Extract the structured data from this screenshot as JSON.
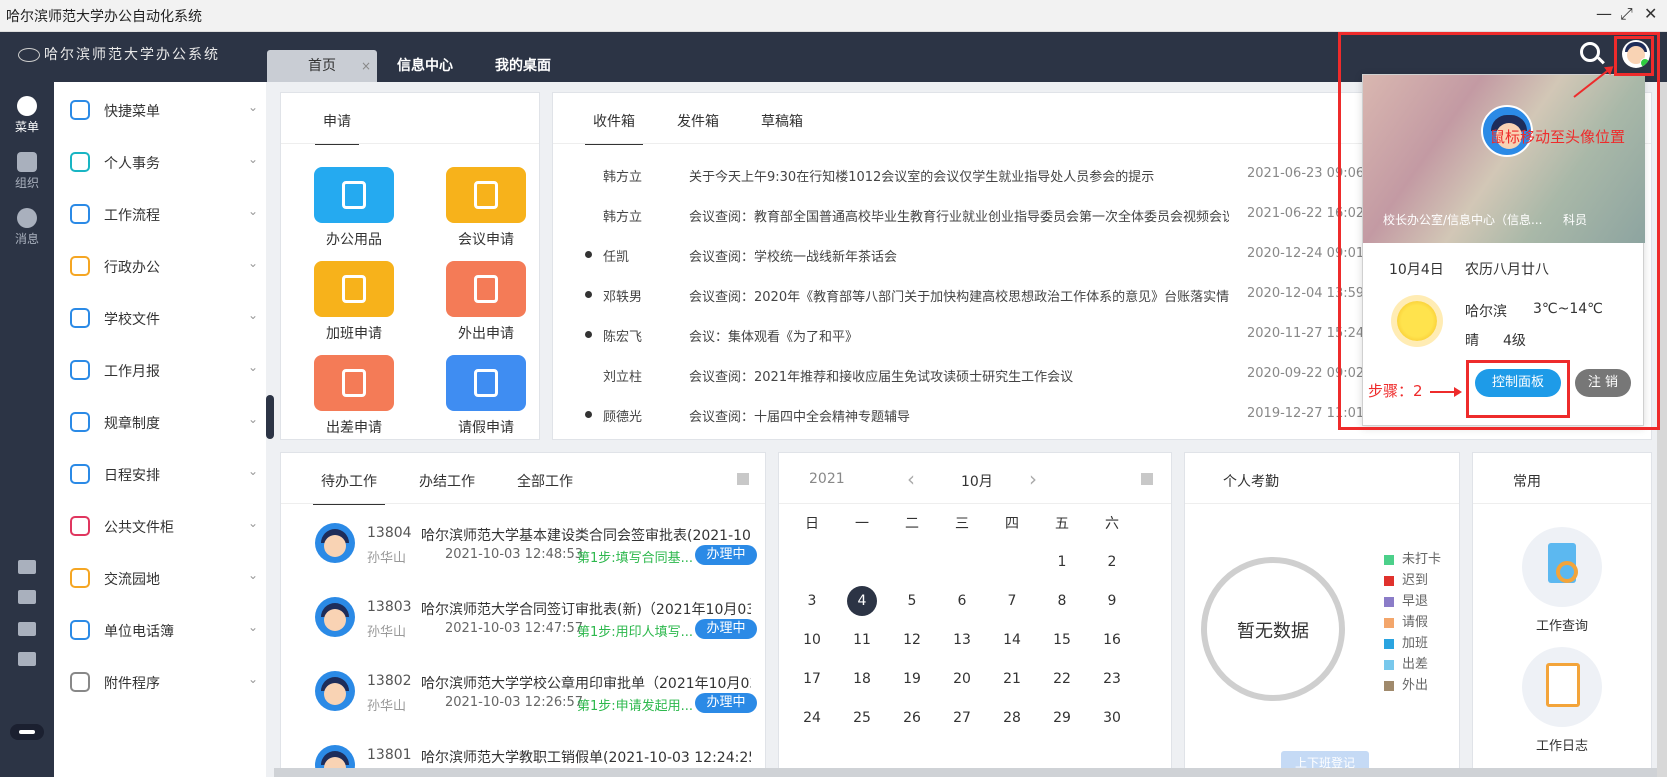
{
  "window": {
    "title": "哈尔滨师范大学办公自动化系统",
    "controls": [
      "—",
      "⤢",
      "✕"
    ]
  },
  "header": {
    "logo_text": "哈尔滨师范大学办公系统",
    "tabs": [
      {
        "label": "首页",
        "close": "×"
      },
      {
        "label": "信息中心"
      },
      {
        "label": "我的桌面"
      }
    ]
  },
  "rail": {
    "items": [
      {
        "label": "菜单",
        "icon": "grid-icon"
      },
      {
        "label": "组织",
        "icon": "people-icon"
      },
      {
        "label": "消息",
        "icon": "chat-icon"
      }
    ]
  },
  "sidebar": {
    "items": [
      {
        "label": "快捷菜单",
        "icon": "grid-menu-icon",
        "color": "#2b8ae6"
      },
      {
        "label": "个人事务",
        "icon": "user-icon",
        "color": "#19b5c3"
      },
      {
        "label": "工作流程",
        "icon": "workflow-icon",
        "color": "#2b8ae6"
      },
      {
        "label": "行政办公",
        "icon": "briefcase-icon",
        "color": "#f5a623"
      },
      {
        "label": "学校文件",
        "icon": "grid-menu-icon",
        "color": "#2b8ae6"
      },
      {
        "label": "工作月报",
        "icon": "grid-menu-icon",
        "color": "#2b8ae6"
      },
      {
        "label": "规章制度",
        "icon": "grid-menu-icon",
        "color": "#2b8ae6"
      },
      {
        "label": "日程安排",
        "icon": "grid-menu-icon",
        "color": "#2b8ae6"
      },
      {
        "label": "公共文件柜",
        "icon": "cabinet-icon",
        "color": "#e0365f"
      },
      {
        "label": "交流园地",
        "icon": "cup-icon",
        "color": "#f5a623"
      },
      {
        "label": "单位电话簿",
        "icon": "grid-menu-icon",
        "color": "#2b8ae6"
      },
      {
        "label": "附件程序",
        "icon": "paperclip-icon",
        "color": "#888888"
      }
    ]
  },
  "apply": {
    "tab": "申请",
    "apps": [
      {
        "label": "办公用品",
        "color": "#25aaf0"
      },
      {
        "label": "会议申请",
        "color": "#f7b21b"
      },
      {
        "label": "加班申请",
        "color": "#f7b21b"
      },
      {
        "label": "外出申请",
        "color": "#f47b57"
      },
      {
        "label": "出差申请",
        "color": "#f47b57"
      },
      {
        "label": "请假申请",
        "color": "#3f8df2"
      }
    ]
  },
  "mail": {
    "tabs": [
      "收件箱",
      "发件箱",
      "草稿箱"
    ],
    "rows": [
      {
        "unread": false,
        "from": "韩方立",
        "subject": "关于今天上午9:30在行知楼1012会议室的会议仅学生就业指导处人员参会的提示",
        "date": "2021-06-23 09:06"
      },
      {
        "unread": false,
        "from": "韩方立",
        "subject": "会议查阅：教育部全国普通高校毕业生教育行业就业创业指导委员会第一次全体委员会视频会议",
        "date": "2021-06-22 16:02"
      },
      {
        "unread": true,
        "from": "任凯",
        "subject": "会议查阅：学校统一战线新年茶话会",
        "date": "2020-12-24 09:01"
      },
      {
        "unread": true,
        "from": "邓轶男",
        "subject": "会议查阅：2020年《教育部等八部门关于加快构建高校思想政治工作体系的意见》台账落实情...",
        "date": "2020-12-04 13:59"
      },
      {
        "unread": true,
        "from": "陈宏飞",
        "subject": "会议：集体观看《为了和平》",
        "date": "2020-11-27 15:24"
      },
      {
        "unread": false,
        "from": "刘立柱",
        "subject": "会议查阅：2021年推荐和接收应届生免试攻读硕士研究生工作会议",
        "date": "2020-09-22 09:02"
      },
      {
        "unread": true,
        "from": "顾德光",
        "subject": "会议查阅：十届四中全会精神专题辅导",
        "date": "2019-12-27 11:01"
      }
    ]
  },
  "work": {
    "tabs": [
      "待办工作",
      "办结工作",
      "全部工作"
    ],
    "items": [
      {
        "no": "13804",
        "title": "哈尔滨师范大学基本建设类合同会签审批表(2021-10-...",
        "user": "孙华山",
        "time": "2021-10-03 12:48:53",
        "step": "第1步:填写合同基...",
        "status": "办理中"
      },
      {
        "no": "13803",
        "title": "哈尔滨师范大学合同签订审批表(新)（2021年10月03...",
        "user": "孙华山",
        "time": "2021-10-03 12:47:57",
        "step": "第1步:用印人填写...",
        "status": "办理中"
      },
      {
        "no": "13802",
        "title": "哈尔滨师范大学学校公章用印审批单（2021年10月03...",
        "user": "孙华山",
        "time": "2021-10-03 12:26:57",
        "step": "第1步:申请发起用...",
        "status": "办理中"
      },
      {
        "no": "13801",
        "title": "哈尔滨师范大学教职工销假单(2021-10-03 12:24:25)",
        "user": "",
        "time": "",
        "step": "",
        "status": ""
      }
    ]
  },
  "calendar": {
    "year": "2021",
    "month": "10月",
    "weekdays": [
      "日",
      "一",
      "二",
      "三",
      "四",
      "五",
      "六"
    ],
    "today": "4",
    "weeks": [
      [
        "",
        "",
        "",
        "",
        "",
        "1",
        "2"
      ],
      [
        "3",
        "4",
        "5",
        "6",
        "7",
        "8",
        "9"
      ],
      [
        "10",
        "11",
        "12",
        "13",
        "14",
        "15",
        "16"
      ],
      [
        "17",
        "18",
        "19",
        "20",
        "21",
        "22",
        "23"
      ],
      [
        "24",
        "25",
        "26",
        "27",
        "28",
        "29",
        "30"
      ]
    ]
  },
  "attendance": {
    "title": "个人考勤",
    "empty_text": "暂无数据",
    "button": "上下班登记",
    "legend": [
      {
        "label": "未打卡",
        "color": "#4cd08a"
      },
      {
        "label": "迟到",
        "color": "#e0322d"
      },
      {
        "label": "早退",
        "color": "#8b7cc8"
      },
      {
        "label": "请假",
        "color": "#f3a66b"
      },
      {
        "label": "加班",
        "color": "#2aa4e0"
      },
      {
        "label": "出差",
        "color": "#78c8ec"
      },
      {
        "label": "外出",
        "color": "#a08a6c"
      }
    ]
  },
  "common": {
    "title": "常用",
    "items": [
      {
        "label": "工作查询",
        "icon": "magnifier-doc-icon"
      },
      {
        "label": "工作日志",
        "icon": "notebook-icon"
      }
    ]
  },
  "profile_popup": {
    "dept": "校长办公室/信息中心（信息...",
    "rank": "科员",
    "date": "10月4日",
    "lunar": "农历八月廿八",
    "city": "哈尔滨",
    "temp": "3℃~14℃",
    "weather": "晴",
    "wind": "4级",
    "control_button": "控制面板",
    "logout_button": "注 销"
  },
  "annotations": {
    "step1": "鼠标移动至头像位置",
    "step2": "步骤：2"
  },
  "colors": {
    "nav_dark": "#2c3445",
    "accent_blue": "#2b8ae6",
    "annotation_red": "#ee2b2b"
  }
}
